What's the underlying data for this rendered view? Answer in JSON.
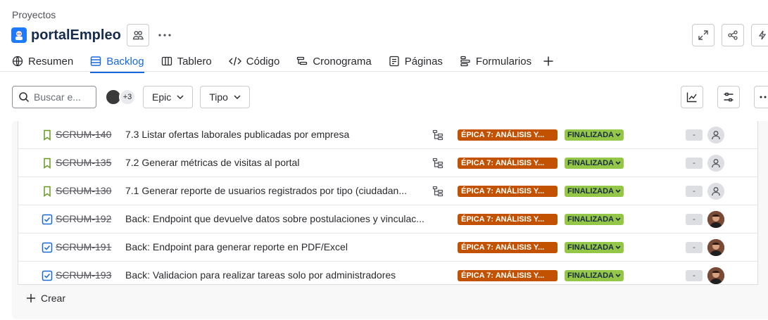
{
  "breadcrumb": "Proyectos",
  "project": {
    "title": "portalEmpleo"
  },
  "tabs": [
    {
      "label": "Resumen",
      "icon": "globe-icon"
    },
    {
      "label": "Backlog",
      "icon": "backlog-icon",
      "active": true
    },
    {
      "label": "Tablero",
      "icon": "board-icon"
    },
    {
      "label": "Código",
      "icon": "code-icon"
    },
    {
      "label": "Cronograma",
      "icon": "timeline-icon"
    },
    {
      "label": "Páginas",
      "icon": "pages-icon"
    },
    {
      "label": "Formularios",
      "icon": "forms-icon"
    }
  ],
  "filters": {
    "search_placeholder": "Buscar e...",
    "avatars_more": "+3",
    "epic_label": "Epic",
    "type_label": "Tipo"
  },
  "colors": {
    "accent": "#1868db",
    "epic": "#c25100",
    "status_done": "#94c748"
  },
  "rows": [
    {
      "key": "SCRUM-140",
      "summary": "7.3 Listar ofertas laborales publicadas por empresa",
      "type": "story",
      "has_children": true,
      "epic": "ÉPICA 7: ANÁLISIS Y...",
      "status": "FINALIZADA",
      "estimate": "-",
      "assignee": "unassigned"
    },
    {
      "key": "SCRUM-135",
      "summary": "7.2 Generar métricas de visitas al portal",
      "type": "story",
      "has_children": true,
      "epic": "ÉPICA 7: ANÁLISIS Y...",
      "status": "FINALIZADA",
      "estimate": "-",
      "assignee": "unassigned"
    },
    {
      "key": "SCRUM-130",
      "summary": "7.1 Generar reporte de usuarios registrados por tipo (ciudadan...",
      "type": "story",
      "has_children": true,
      "epic": "ÉPICA 7: ANÁLISIS Y...",
      "status": "FINALIZADA",
      "estimate": "-",
      "assignee": "unassigned"
    },
    {
      "key": "SCRUM-192",
      "summary": "Back: Endpoint que devuelve datos sobre postulaciones y vinculac...",
      "type": "task",
      "has_children": false,
      "epic": "ÉPICA 7: ANÁLISIS Y...",
      "status": "FINALIZADA",
      "estimate": "-",
      "assignee": "user"
    },
    {
      "key": "SCRUM-191",
      "summary": "Back: Endpoint para generar reporte en PDF/Excel",
      "type": "task",
      "has_children": false,
      "epic": "ÉPICA 7: ANÁLISIS Y...",
      "status": "FINALIZADA",
      "estimate": "-",
      "assignee": "user"
    },
    {
      "key": "SCRUM-193",
      "summary": "Back: Validacion para realizar tareas solo por administradores",
      "type": "task",
      "has_children": false,
      "epic": "ÉPICA 7: ANÁLISIS Y...",
      "status": "FINALIZADA",
      "estimate": "-",
      "assignee": "user"
    }
  ],
  "create_label": "Crear"
}
